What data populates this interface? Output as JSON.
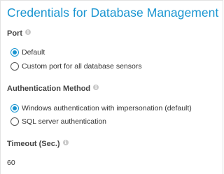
{
  "panel": {
    "title": "Credentials for Database Management Systems"
  },
  "port": {
    "label": "Port",
    "info_icon": "i",
    "options": [
      {
        "label": "Default",
        "selected": true
      },
      {
        "label": "Custom port for all database sensors",
        "selected": false
      }
    ]
  },
  "authentication": {
    "label": "Authentication Method",
    "info_icon": "i",
    "options": [
      {
        "label": "Windows authentication with impersonation (default)",
        "selected": true
      },
      {
        "label": "SQL server authentication",
        "selected": false
      }
    ]
  },
  "timeout": {
    "label": "Timeout (Sec.)",
    "info_icon": "i",
    "value": "60"
  },
  "colors": {
    "accent": "#1a95d1",
    "text": "#333333",
    "info_icon": "#c9c9c9"
  }
}
